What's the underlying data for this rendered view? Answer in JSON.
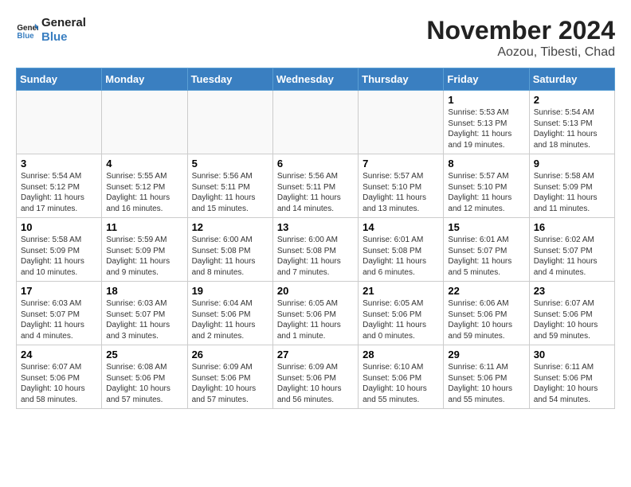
{
  "logo": {
    "line1": "General",
    "line2": "Blue"
  },
  "title": "November 2024",
  "subtitle": "Aozou, Tibesti, Chad",
  "days_header": [
    "Sunday",
    "Monday",
    "Tuesday",
    "Wednesday",
    "Thursday",
    "Friday",
    "Saturday"
  ],
  "weeks": [
    [
      {
        "day": "",
        "info": ""
      },
      {
        "day": "",
        "info": ""
      },
      {
        "day": "",
        "info": ""
      },
      {
        "day": "",
        "info": ""
      },
      {
        "day": "",
        "info": ""
      },
      {
        "day": "1",
        "info": "Sunrise: 5:53 AM\nSunset: 5:13 PM\nDaylight: 11 hours and 19 minutes."
      },
      {
        "day": "2",
        "info": "Sunrise: 5:54 AM\nSunset: 5:13 PM\nDaylight: 11 hours and 18 minutes."
      }
    ],
    [
      {
        "day": "3",
        "info": "Sunrise: 5:54 AM\nSunset: 5:12 PM\nDaylight: 11 hours and 17 minutes."
      },
      {
        "day": "4",
        "info": "Sunrise: 5:55 AM\nSunset: 5:12 PM\nDaylight: 11 hours and 16 minutes."
      },
      {
        "day": "5",
        "info": "Sunrise: 5:56 AM\nSunset: 5:11 PM\nDaylight: 11 hours and 15 minutes."
      },
      {
        "day": "6",
        "info": "Sunrise: 5:56 AM\nSunset: 5:11 PM\nDaylight: 11 hours and 14 minutes."
      },
      {
        "day": "7",
        "info": "Sunrise: 5:57 AM\nSunset: 5:10 PM\nDaylight: 11 hours and 13 minutes."
      },
      {
        "day": "8",
        "info": "Sunrise: 5:57 AM\nSunset: 5:10 PM\nDaylight: 11 hours and 12 minutes."
      },
      {
        "day": "9",
        "info": "Sunrise: 5:58 AM\nSunset: 5:09 PM\nDaylight: 11 hours and 11 minutes."
      }
    ],
    [
      {
        "day": "10",
        "info": "Sunrise: 5:58 AM\nSunset: 5:09 PM\nDaylight: 11 hours and 10 minutes."
      },
      {
        "day": "11",
        "info": "Sunrise: 5:59 AM\nSunset: 5:09 PM\nDaylight: 11 hours and 9 minutes."
      },
      {
        "day": "12",
        "info": "Sunrise: 6:00 AM\nSunset: 5:08 PM\nDaylight: 11 hours and 8 minutes."
      },
      {
        "day": "13",
        "info": "Sunrise: 6:00 AM\nSunset: 5:08 PM\nDaylight: 11 hours and 7 minutes."
      },
      {
        "day": "14",
        "info": "Sunrise: 6:01 AM\nSunset: 5:08 PM\nDaylight: 11 hours and 6 minutes."
      },
      {
        "day": "15",
        "info": "Sunrise: 6:01 AM\nSunset: 5:07 PM\nDaylight: 11 hours and 5 minutes."
      },
      {
        "day": "16",
        "info": "Sunrise: 6:02 AM\nSunset: 5:07 PM\nDaylight: 11 hours and 4 minutes."
      }
    ],
    [
      {
        "day": "17",
        "info": "Sunrise: 6:03 AM\nSunset: 5:07 PM\nDaylight: 11 hours and 4 minutes."
      },
      {
        "day": "18",
        "info": "Sunrise: 6:03 AM\nSunset: 5:07 PM\nDaylight: 11 hours and 3 minutes."
      },
      {
        "day": "19",
        "info": "Sunrise: 6:04 AM\nSunset: 5:06 PM\nDaylight: 11 hours and 2 minutes."
      },
      {
        "day": "20",
        "info": "Sunrise: 6:05 AM\nSunset: 5:06 PM\nDaylight: 11 hours and 1 minute."
      },
      {
        "day": "21",
        "info": "Sunrise: 6:05 AM\nSunset: 5:06 PM\nDaylight: 11 hours and 0 minutes."
      },
      {
        "day": "22",
        "info": "Sunrise: 6:06 AM\nSunset: 5:06 PM\nDaylight: 10 hours and 59 minutes."
      },
      {
        "day": "23",
        "info": "Sunrise: 6:07 AM\nSunset: 5:06 PM\nDaylight: 10 hours and 59 minutes."
      }
    ],
    [
      {
        "day": "24",
        "info": "Sunrise: 6:07 AM\nSunset: 5:06 PM\nDaylight: 10 hours and 58 minutes."
      },
      {
        "day": "25",
        "info": "Sunrise: 6:08 AM\nSunset: 5:06 PM\nDaylight: 10 hours and 57 minutes."
      },
      {
        "day": "26",
        "info": "Sunrise: 6:09 AM\nSunset: 5:06 PM\nDaylight: 10 hours and 57 minutes."
      },
      {
        "day": "27",
        "info": "Sunrise: 6:09 AM\nSunset: 5:06 PM\nDaylight: 10 hours and 56 minutes."
      },
      {
        "day": "28",
        "info": "Sunrise: 6:10 AM\nSunset: 5:06 PM\nDaylight: 10 hours and 55 minutes."
      },
      {
        "day": "29",
        "info": "Sunrise: 6:11 AM\nSunset: 5:06 PM\nDaylight: 10 hours and 55 minutes."
      },
      {
        "day": "30",
        "info": "Sunrise: 6:11 AM\nSunset: 5:06 PM\nDaylight: 10 hours and 54 minutes."
      }
    ]
  ]
}
